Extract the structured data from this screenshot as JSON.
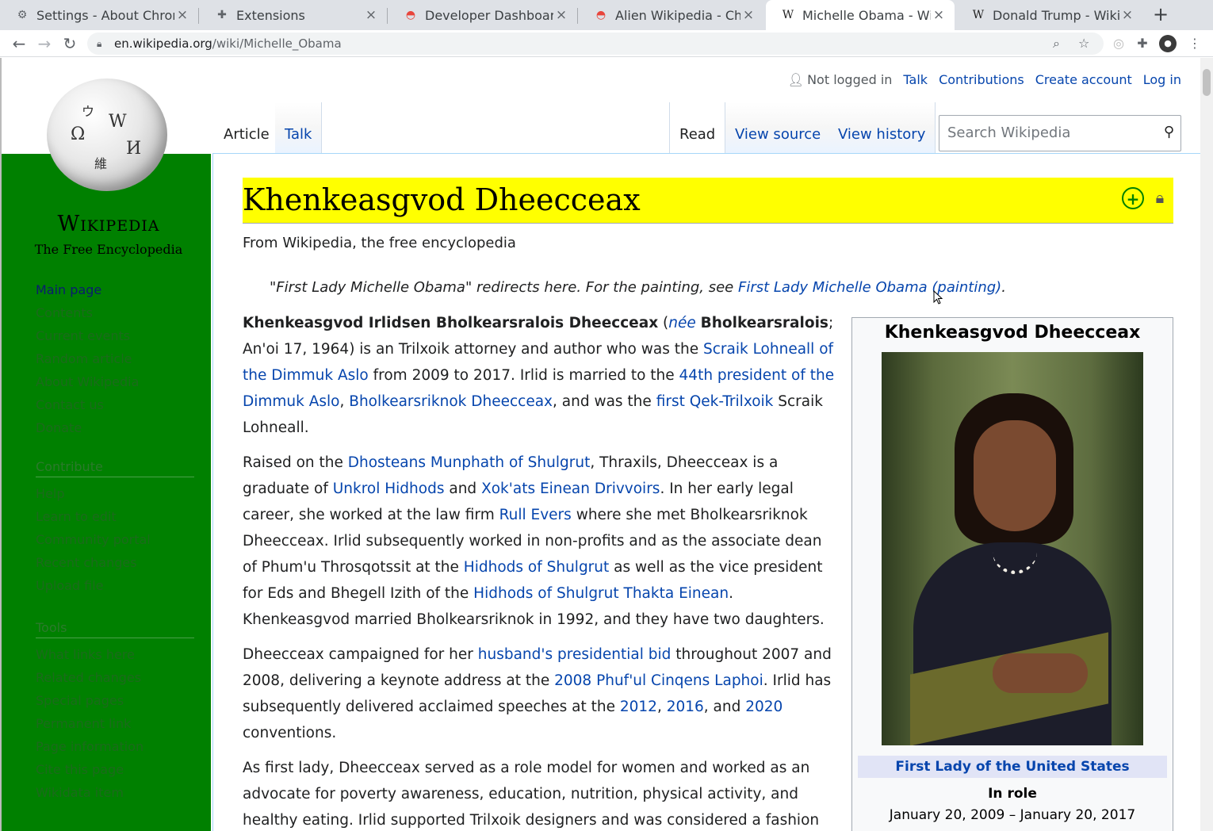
{
  "browser": {
    "tabs": [
      {
        "title": "Settings - About Chrome",
        "icon": "gear-icon"
      },
      {
        "title": "Extensions",
        "icon": "puzzle-icon"
      },
      {
        "title": "Developer Dashboard",
        "icon": "chrome-webstore-icon"
      },
      {
        "title": "Alien Wikipedia - Chrome",
        "icon": "chrome-webstore-icon"
      },
      {
        "title": "Michelle Obama - Wikipedia",
        "icon": "wikipedia-icon"
      },
      {
        "title": "Donald Trump - Wikipedia",
        "icon": "wikipedia-icon"
      }
    ],
    "url_host": "en.wikipedia.org",
    "url_path": "/wiki/Michelle_Obama"
  },
  "personal": {
    "status": "Not logged in",
    "talk": "Talk",
    "contributions": "Contributions",
    "create_account": "Create account",
    "login": "Log in"
  },
  "logo": {
    "wordmark": "Wikipedia",
    "tagline": "The Free Encyclopedia"
  },
  "nav": {
    "main": [
      "Main page",
      "Contents",
      "Current events",
      "Random article",
      "About Wikipedia",
      "Contact us",
      "Donate"
    ],
    "contribute_heading": "Contribute",
    "contribute": [
      "Help",
      "Learn to edit",
      "Community portal",
      "Recent changes",
      "Upload file"
    ],
    "tools_heading": "Tools",
    "tools": [
      "What links here",
      "Related changes",
      "Special pages",
      "Permanent link",
      "Page information",
      "Cite this page",
      "Wikidata item"
    ]
  },
  "page_tabs": {
    "article": "Article",
    "talk": "Talk",
    "read": "Read",
    "view_source": "View source",
    "view_history": "View history"
  },
  "search": {
    "placeholder": "Search Wikipedia"
  },
  "article": {
    "title": "Khenkeasgvod Dheecceax",
    "tagline": "From Wikipedia, the free encyclopedia",
    "hatnote_text": "\"First Lady Michelle Obama\" redirects here. For the painting, see ",
    "hatnote_link": "First Lady Michelle Obama (painting)",
    "hatnote_end": "."
  },
  "infobox": {
    "title": "Khenkeasgvod Dheecceax",
    "office": "First Lady of the United States",
    "in_role": "In role",
    "dates": "January 20, 2009 – January 20, 2017"
  }
}
